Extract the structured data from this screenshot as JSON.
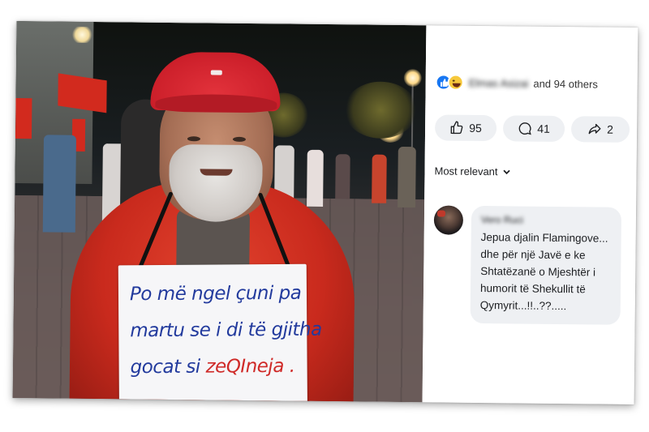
{
  "photo": {
    "sign_lines": [
      {
        "text": "Po më ngel çuni pa",
        "accent": ""
      },
      {
        "text": "martu se i di të gjitha",
        "accent": ""
      },
      {
        "text": "gocat si ",
        "accent": "zeQIneja ."
      }
    ]
  },
  "reactions": {
    "icons": [
      "like-icon",
      "haha-icon"
    ],
    "name": "Elmas Asizai",
    "others": "and 94 others"
  },
  "actions": {
    "likes": "95",
    "comments": "41",
    "shares": "2"
  },
  "sort": {
    "label": "Most relevant"
  },
  "comment": {
    "author": "Vero Ruci",
    "text": "Jepua djalin Flamingove... dhe për një Javë e ke Shtatëzanë o Mjeshtër i humorit të Shekullit të Qymyrit...!!..??....."
  },
  "colors": {
    "like_blue": "#1877f2",
    "sign_blue": "#223a9d",
    "sign_red": "#cf2a28",
    "cap_red": "#cc1f2a"
  }
}
